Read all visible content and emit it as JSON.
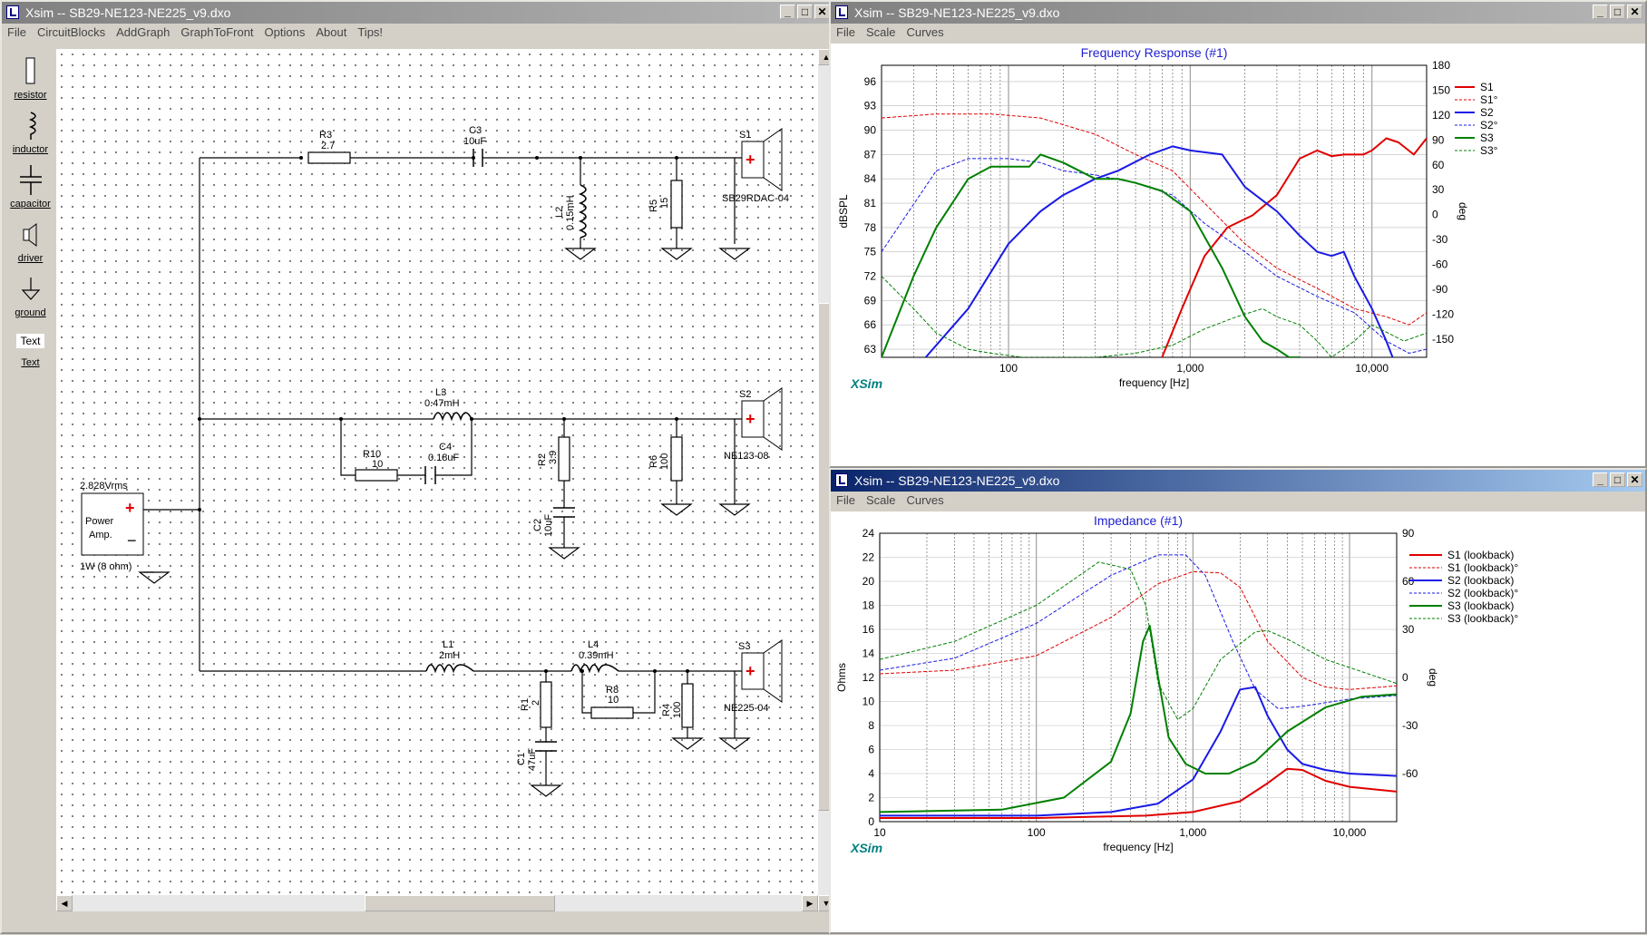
{
  "windows": {
    "schematic": {
      "title": "Xsim -- SB29-NE123-NE225_v9.dxo",
      "menu": [
        "File",
        "CircuitBlocks",
        "AddGraph",
        "GraphToFront",
        "Options",
        "About",
        "Tips!"
      ]
    },
    "freq": {
      "title": "Xsim -- SB29-NE123-NE225_v9.dxo",
      "menu": [
        "File",
        "Scale",
        "Curves"
      ]
    },
    "imp": {
      "title": "Xsim -- SB29-NE123-NE225_v9.dxo",
      "menu": [
        "File",
        "Scale",
        "Curves"
      ]
    }
  },
  "window_buttons": {
    "min": "_",
    "max": "□",
    "close": "✕"
  },
  "toolbox": [
    {
      "label": "resistor",
      "icon": "resistor-icon"
    },
    {
      "label": "inductor",
      "icon": "inductor-icon"
    },
    {
      "label": "capacitor",
      "icon": "capacitor-icon"
    },
    {
      "label": "driver",
      "icon": "driver-icon"
    },
    {
      "label": "ground",
      "icon": "ground-icon"
    },
    {
      "label": "Text",
      "icon": "text-icon"
    }
  ],
  "schematic": {
    "amp": {
      "label1": "Power",
      "label2": "Amp.",
      "voltage": "2.828Vrms",
      "power": "1W (8 ohm)",
      "plus": "+",
      "minus": "−"
    },
    "components": {
      "R3": {
        "name": "R3",
        "value": "2.7"
      },
      "C3": {
        "name": "C3",
        "value": "10uF"
      },
      "L2": {
        "name": "L2",
        "value": "0.15mH"
      },
      "R5": {
        "name": "R5",
        "value": "15"
      },
      "S1": {
        "name": "S1",
        "value": "SB29RDAC-04"
      },
      "L3": {
        "name": "L3",
        "value": "0.47mH"
      },
      "R10": {
        "name": "R10",
        "value": "10"
      },
      "C4": {
        "name": "C4",
        "value": "0.18uF"
      },
      "R2": {
        "name": "R2",
        "value": "3.9"
      },
      "C2": {
        "name": "C2",
        "value": "10uF"
      },
      "R6": {
        "name": "R6",
        "value": "100"
      },
      "S2": {
        "name": "S2",
        "value": "NE123-08"
      },
      "L1": {
        "name": "L1",
        "value": "2mH"
      },
      "L4": {
        "name": "L4",
        "value": "0.39mH"
      },
      "R8": {
        "name": "R8",
        "value": "10"
      },
      "R1": {
        "name": "R1",
        "value": "2"
      },
      "C1": {
        "name": "C1",
        "value": "47uF"
      },
      "R4": {
        "name": "R4",
        "value": "100"
      },
      "S3": {
        "name": "S3",
        "value": "NE225-04"
      }
    }
  },
  "chart_data": [
    {
      "type": "line",
      "title": "Frequency Response (#1)",
      "xlabel": "frequency [Hz]",
      "ylabel": "dBSPL",
      "y2label": "deg",
      "xscale": "log",
      "xlim": [
        20,
        20000
      ],
      "ylim": [
        62,
        98
      ],
      "y2lim": [
        -172,
        180
      ],
      "xticks": [
        {
          "v": 100,
          "t": "100"
        },
        {
          "v": 1000,
          "t": "1,000"
        },
        {
          "v": 10000,
          "t": "10,000"
        }
      ],
      "yticks": [
        63,
        66,
        69,
        72,
        75,
        78,
        81,
        84,
        87,
        90,
        93,
        96
      ],
      "y2ticks": [
        -150,
        -120,
        -90,
        -60,
        -30,
        0,
        30,
        60,
        90,
        120,
        150,
        180
      ],
      "watermark": "XSim",
      "legend_position": "right",
      "series": [
        {
          "name": "S1",
          "color": "#e00000",
          "dash": false,
          "width": 2,
          "axis": "y",
          "x": [
            700,
            900,
            1200,
            1600,
            2200,
            3000,
            4000,
            5000,
            6000,
            7000,
            8000,
            9000,
            10000,
            12000,
            14000,
            17000,
            20000
          ],
          "y": [
            62,
            68,
            74.5,
            78,
            79.5,
            82,
            86.5,
            87.5,
            86.8,
            87,
            87,
            87,
            87.5,
            89,
            88.5,
            87,
            89
          ]
        },
        {
          "name": "S1°",
          "color": "#e00000",
          "dash": true,
          "width": 1,
          "axis": "y",
          "x": [
            20,
            40,
            80,
            150,
            300,
            500,
            800,
            1200,
            2000,
            3000,
            5000,
            8000,
            12000,
            16000,
            20000
          ],
          "y": [
            91.5,
            92,
            92,
            91.5,
            89.5,
            87,
            85,
            81,
            76,
            73,
            70.5,
            68,
            67,
            66,
            67.5
          ]
        },
        {
          "name": "S2",
          "color": "#1a1ae6",
          "dash": false,
          "width": 2,
          "axis": "y",
          "x": [
            35,
            60,
            100,
            150,
            200,
            300,
            400,
            600,
            800,
            1000,
            1500,
            2000,
            3000,
            4000,
            5000,
            6000,
            7000,
            8000,
            10000,
            12000,
            13000
          ],
          "y": [
            62,
            68,
            76,
            80,
            82,
            84,
            85,
            87,
            88,
            87.5,
            87,
            83,
            80,
            77,
            75,
            74.5,
            75,
            72,
            68,
            64,
            62
          ]
        },
        {
          "name": "S2°",
          "color": "#1a1ae6",
          "dash": true,
          "width": 1,
          "axis": "y",
          "x": [
            20,
            40,
            60,
            100,
            150,
            200,
            300,
            500,
            800,
            1200,
            2000,
            3000,
            5000,
            8000,
            12000,
            16000,
            20000
          ],
          "y": [
            75,
            85,
            86.5,
            86.5,
            86,
            85,
            84.5,
            83.5,
            82,
            78.5,
            75,
            72,
            69.5,
            67.5,
            64,
            62.5,
            63
          ]
        },
        {
          "name": "S3",
          "color": "#008000",
          "dash": false,
          "width": 2,
          "axis": "y",
          "x": [
            20,
            30,
            40,
            60,
            80,
            100,
            130,
            150,
            200,
            300,
            400,
            500,
            700,
            1000,
            1500,
            2000,
            2500,
            3000,
            3500,
            4000
          ],
          "y": [
            62,
            72,
            78,
            84,
            85.5,
            85.5,
            85.5,
            87,
            86,
            84,
            84,
            83.5,
            82.5,
            80,
            73,
            67,
            64,
            63,
            62,
            62
          ]
        },
        {
          "name": "S3°",
          "color": "#008000",
          "dash": true,
          "width": 1,
          "axis": "y",
          "x": [
            20,
            30,
            40,
            60,
            80,
            120,
            200,
            300,
            500,
            800,
            1200,
            1800,
            2500,
            3000,
            4000,
            5000,
            6000,
            8000,
            10000,
            15000,
            20000
          ],
          "y": [
            72,
            68,
            65,
            63,
            62.5,
            62,
            62,
            62,
            62.5,
            63.5,
            65.5,
            67,
            68,
            67,
            66,
            64,
            62,
            64,
            66,
            64,
            65
          ]
        }
      ]
    },
    {
      "type": "line",
      "title": "Impedance (#1)",
      "xlabel": "frequency [Hz]",
      "ylabel": "Ohms",
      "y2label": "deg",
      "xscale": "log",
      "xlim": [
        10,
        20000
      ],
      "ylim": [
        0,
        24
      ],
      "y2lim": [
        -90,
        90
      ],
      "xticks": [
        {
          "v": 10,
          "t": "10"
        },
        {
          "v": 100,
          "t": "100"
        },
        {
          "v": 1000,
          "t": "1,000"
        },
        {
          "v": 10000,
          "t": "10,000"
        }
      ],
      "yticks": [
        0,
        2,
        4,
        6,
        8,
        10,
        12,
        14,
        16,
        18,
        20,
        22,
        24
      ],
      "y2ticks": [
        -60,
        -30,
        0,
        30,
        60,
        90
      ],
      "watermark": "XSim",
      "legend_position": "right",
      "series": [
        {
          "name": "S1 (lookback)",
          "color": "#e00000",
          "dash": false,
          "width": 2,
          "axis": "y",
          "x": [
            10,
            100,
            500,
            1000,
            2000,
            3000,
            4000,
            5000,
            7000,
            10000,
            20000
          ],
          "y": [
            0.3,
            0.3,
            0.5,
            0.8,
            1.7,
            3.2,
            4.4,
            4.3,
            3.4,
            2.9,
            2.5
          ]
        },
        {
          "name": "S1 (lookback)°",
          "color": "#e00000",
          "dash": true,
          "width": 1,
          "axis": "y",
          "x": [
            10,
            30,
            100,
            300,
            600,
            1000,
            1500,
            2000,
            3000,
            5000,
            7000,
            10000,
            20000
          ],
          "y": [
            12.3,
            12.6,
            13.8,
            17,
            19.8,
            20.8,
            20.7,
            19.5,
            15,
            12,
            11.2,
            11,
            11.3
          ]
        },
        {
          "name": "S2 (lookback)",
          "color": "#1a1ae6",
          "dash": false,
          "width": 2,
          "axis": "y",
          "x": [
            10,
            100,
            300,
            600,
            1000,
            1500,
            2000,
            2500,
            3000,
            4000,
            5000,
            7000,
            10000,
            20000
          ],
          "y": [
            0.5,
            0.5,
            0.8,
            1.5,
            3.5,
            7.5,
            11,
            11.2,
            8.8,
            6,
            4.8,
            4.3,
            4,
            3.8
          ]
        },
        {
          "name": "S2 (lookback)°",
          "color": "#1a1ae6",
          "dash": true,
          "width": 1,
          "axis": "y",
          "x": [
            10,
            30,
            100,
            300,
            600,
            900,
            1200,
            1800,
            2500,
            3500,
            5000,
            10000,
            20000
          ],
          "y": [
            12.6,
            13.6,
            16.5,
            20.5,
            22.2,
            22.2,
            20.5,
            15,
            11,
            9.4,
            9.6,
            10.2,
            10.5
          ]
        },
        {
          "name": "S3 (lookback)",
          "color": "#008000",
          "dash": false,
          "width": 2,
          "axis": "y",
          "x": [
            10,
            60,
            150,
            300,
            400,
            480,
            530,
            600,
            700,
            900,
            1200,
            1700,
            2500,
            4000,
            7000,
            12000,
            20000
          ],
          "y": [
            0.8,
            1,
            2,
            5,
            9,
            15,
            16.3,
            12,
            7,
            4.8,
            4,
            4,
            5,
            7.5,
            9.5,
            10.4,
            10.6
          ]
        },
        {
          "name": "S3 (lookback)°",
          "color": "#008000",
          "dash": true,
          "width": 1,
          "axis": "y",
          "x": [
            10,
            30,
            100,
            250,
            400,
            500,
            600,
            800,
            1000,
            1500,
            2500,
            3000,
            4000,
            7000,
            20000
          ],
          "y": [
            13.5,
            15,
            18,
            21.6,
            21,
            18,
            11.5,
            8.5,
            9.4,
            13.5,
            15.8,
            15.9,
            15.2,
            13.5,
            11.5
          ]
        }
      ]
    }
  ]
}
